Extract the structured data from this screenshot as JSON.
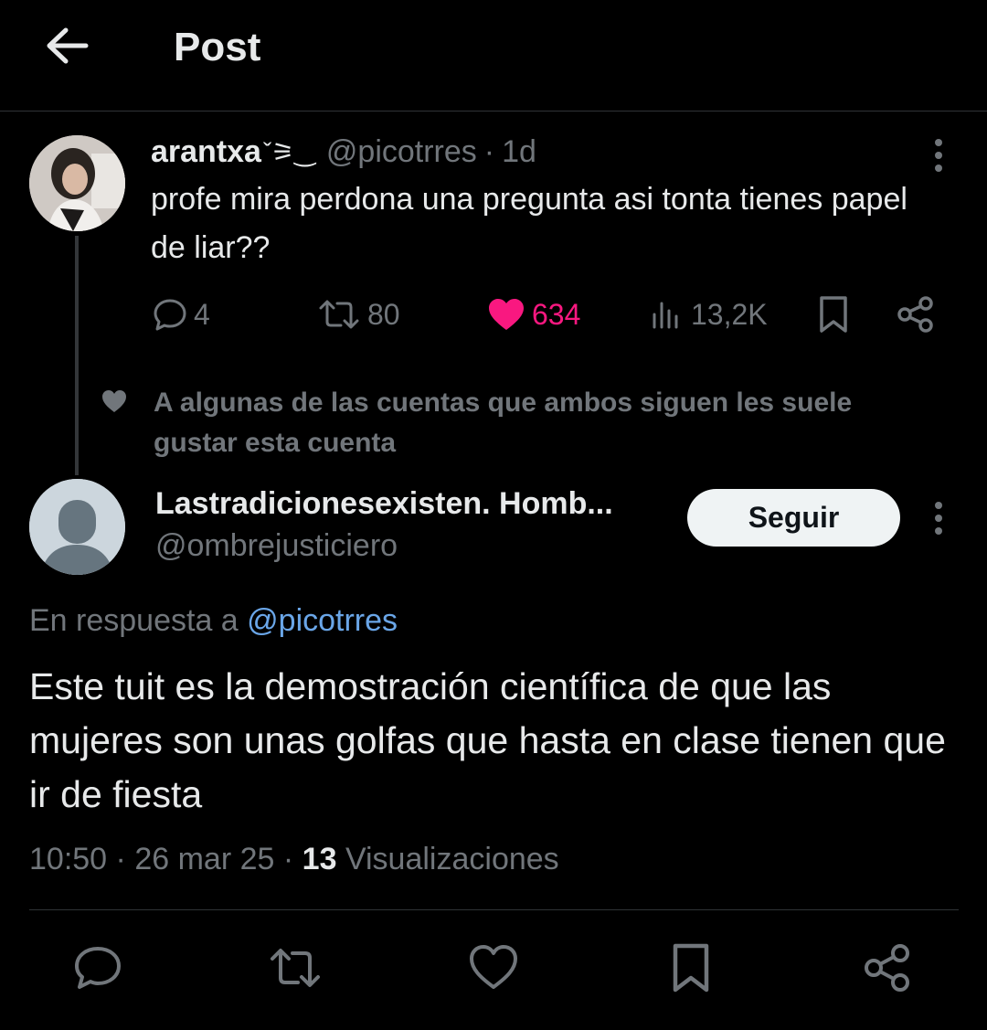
{
  "header": {
    "title": "Post"
  },
  "parent_tweet": {
    "author_name": "arantxa",
    "author_emoji": "ˇ⚞‿",
    "handle": "@picotrres",
    "separator": "·",
    "time": "1d",
    "text": "profe mira perdona una pregunta asi tonta tienes papel de liar??",
    "stats": {
      "replies": "4",
      "retweets": "80",
      "likes": "634",
      "views": "13,2K"
    }
  },
  "social_context": {
    "text": "A algunas de las cuentas que ambos siguen les suele gustar esta cuenta"
  },
  "reply_tweet": {
    "author_name": "Lastradicionesexisten. Homb...",
    "handle": "@ombrejusticiero",
    "follow_label": "Seguir",
    "in_reply_prefix": "En respuesta a",
    "in_reply_handle": "@picotrres",
    "text": "Este tuit es la demostración científica de que las mujeres son unas golfas que hasta en clase tienen que ir de fiesta",
    "time": "10:50",
    "date": "26 mar 25",
    "dot": "·",
    "views_count": "13",
    "views_label": "Visualizaciones"
  },
  "colors": {
    "background": "#000000",
    "text": "#e7e9ea",
    "secondary": "#71767b",
    "like": "#f91880",
    "link": "#6aa6e8",
    "divider": "#2f3336"
  },
  "icons": [
    "arrow-left-icon",
    "more-vertical-icon",
    "reply-icon",
    "retweet-icon",
    "heart-icon",
    "views-icon",
    "bookmark-icon",
    "share-icon",
    "default-avatar-icon"
  ]
}
